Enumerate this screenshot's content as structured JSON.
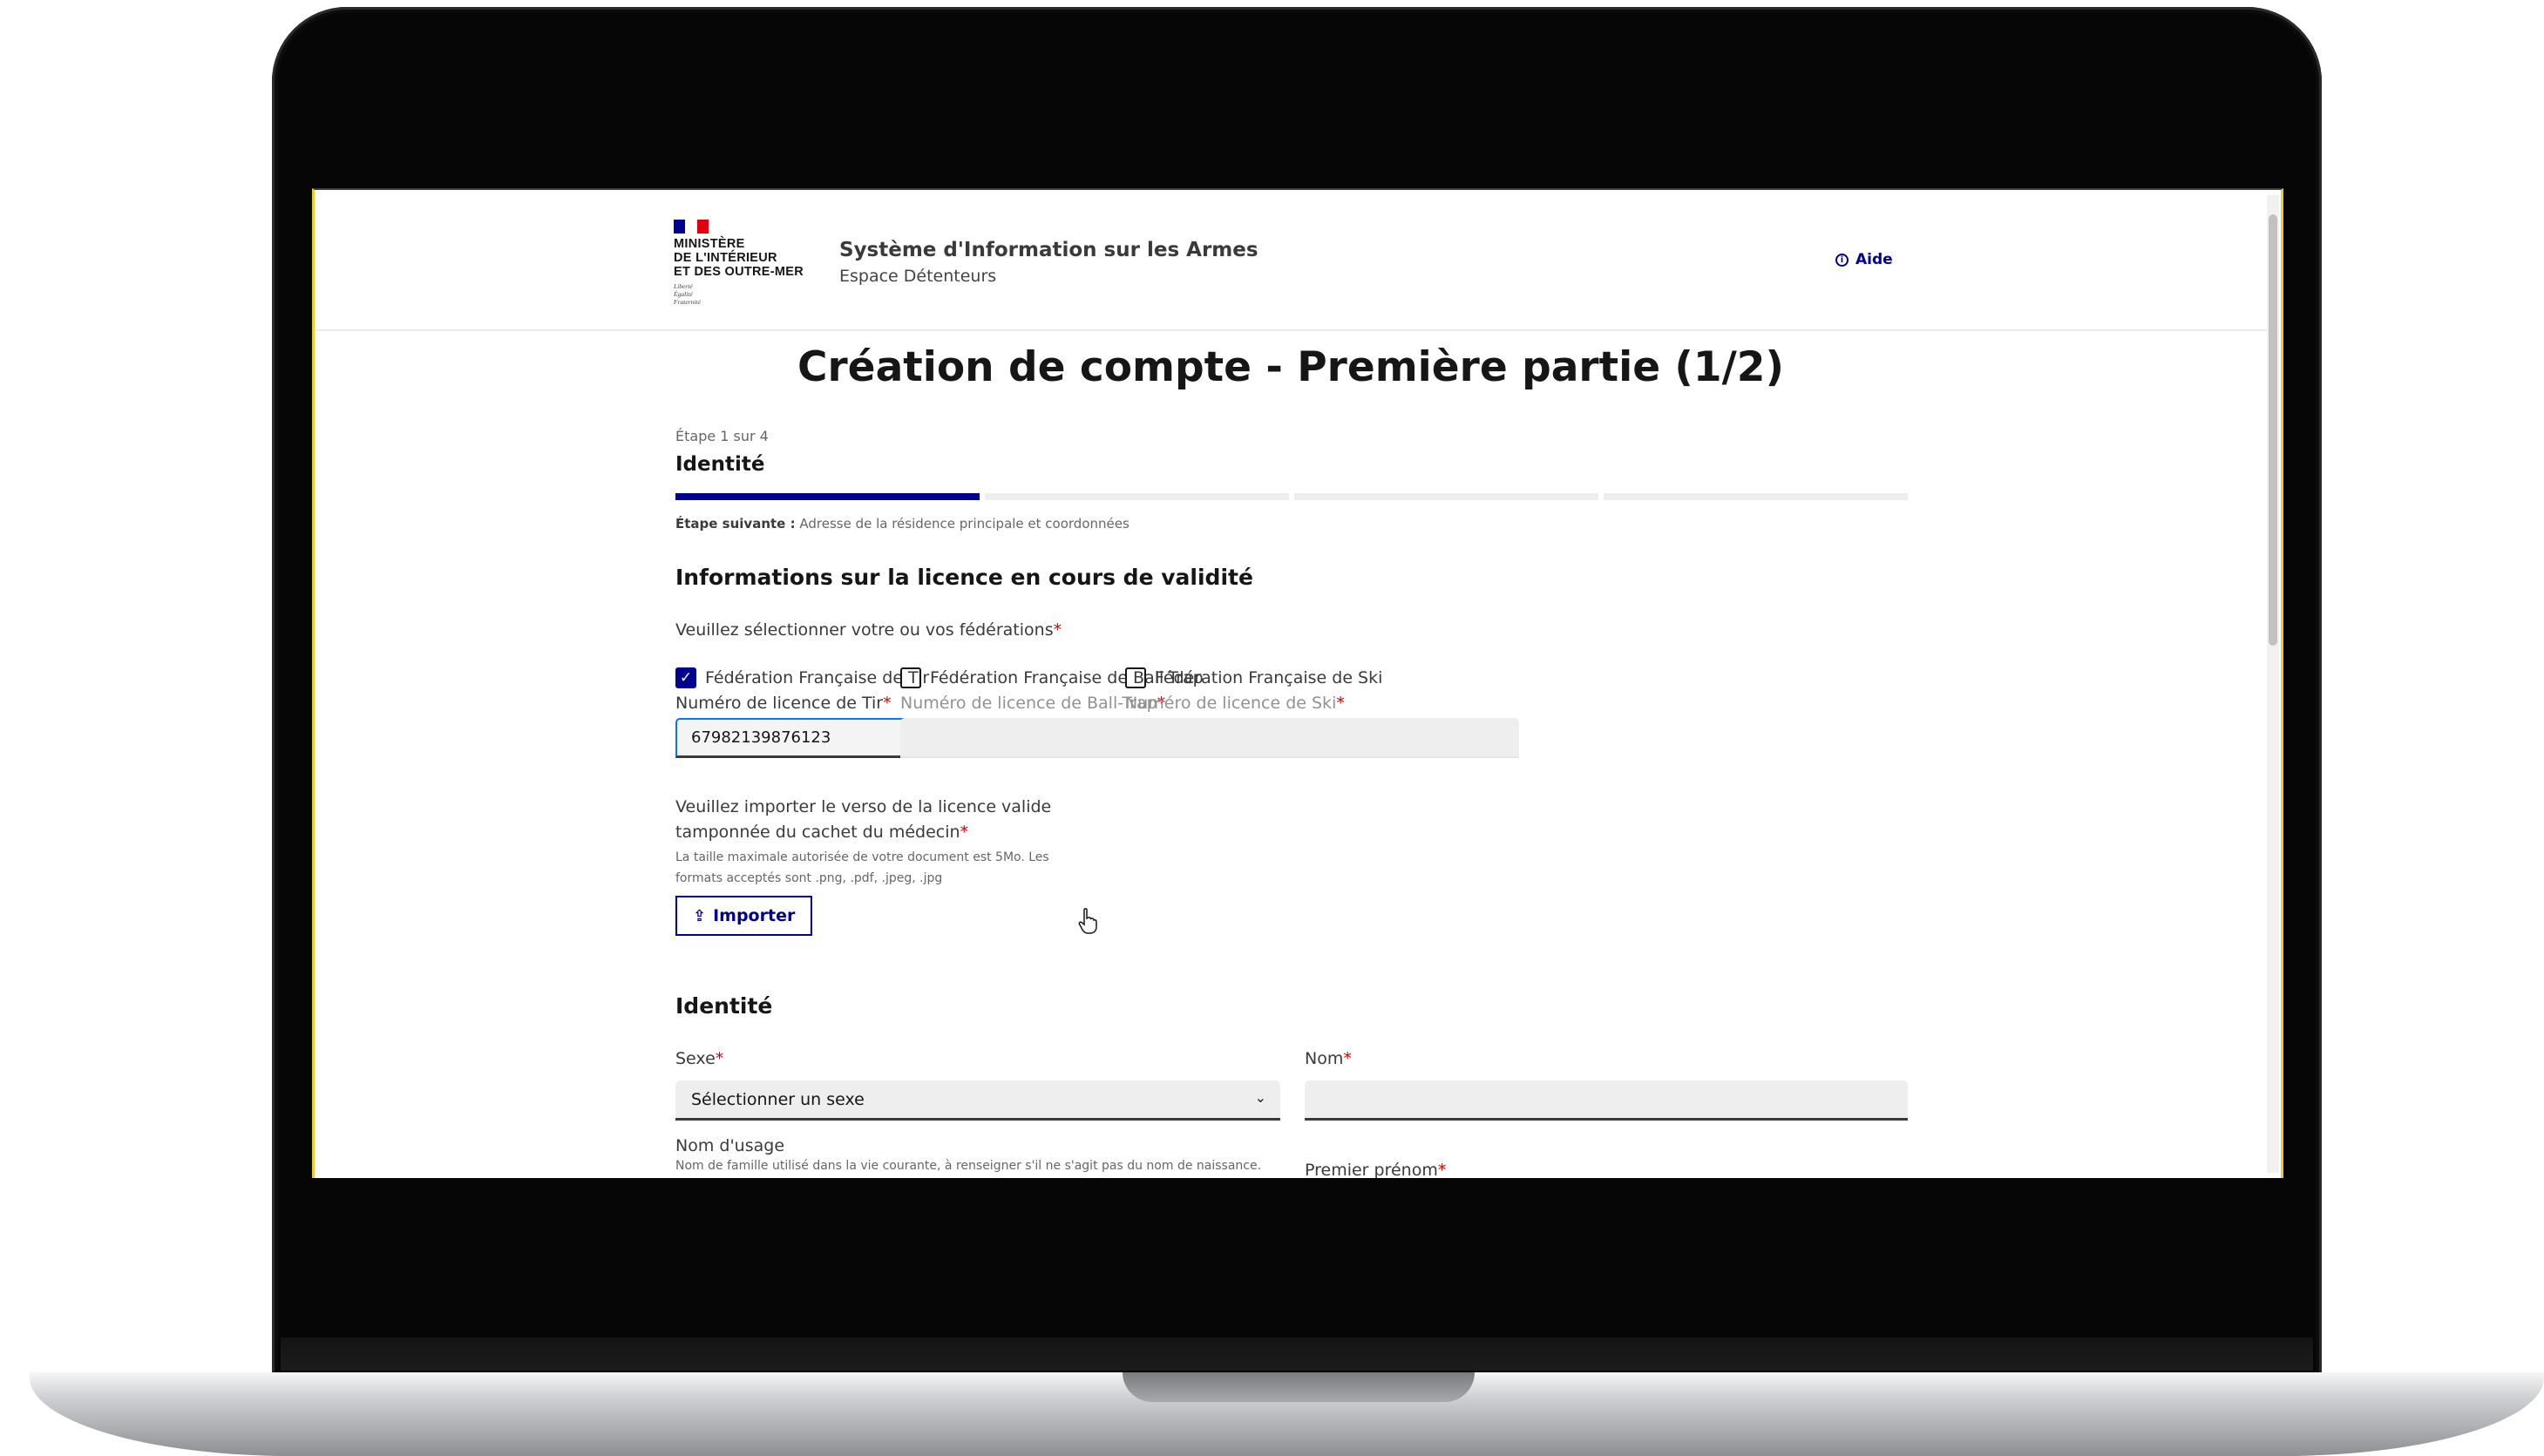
{
  "header": {
    "ministry": "MINISTÈRE\nDE L'INTÉRIEUR\nET DES OUTRE-MER",
    "motto": "Liberté\nÉgalité\nFraternité",
    "service_title": "Système d'Information sur les Armes",
    "service_tagline": "Espace Détenteurs",
    "help_label": "Aide"
  },
  "page": {
    "title": "Création de compte - Première partie (1/2)"
  },
  "stepper": {
    "count": "Étape 1 sur 4",
    "current_title": "Identité",
    "total_steps": 4,
    "current_step": 1,
    "next_prefix": "Étape suivante :",
    "next_title": "Adresse de la résidence principale et coordonnées"
  },
  "licence": {
    "section_title": "Informations sur la licence en cours de validité",
    "legend": "Veuillez sélectionner votre ou vos fédérations",
    "federations": [
      {
        "label": "Fédération Française de Tir",
        "checked": true,
        "field_label": "Numéro de licence de Tir",
        "value": "67982139876123"
      },
      {
        "label": "Fédération Française de Ball-Trap",
        "checked": false,
        "field_label": "Numéro de licence de Ball-Trap",
        "value": ""
      },
      {
        "label": "Fédération Française de Ski",
        "checked": false,
        "field_label": "Numéro de licence de Ski",
        "value": ""
      }
    ],
    "upload_label": "Veuillez importer le verso de la licence valide tamponnée du cachet du médecin",
    "upload_hint": "La taille maximale autorisée de votre document est 5Mo. Les formats acceptés sont .png, .pdf, .jpeg, .jpg",
    "upload_button": "Importer"
  },
  "identity": {
    "section_title": "Identité",
    "sexe_label": "Sexe",
    "sexe_placeholder": "Sélectionner un sexe",
    "nom_label": "Nom",
    "nom_usage_label": "Nom d'usage",
    "nom_usage_hint": "Nom de famille utilisé dans la vie courante, à renseigner s'il ne s'agit pas du nom de naissance.",
    "premier_prenom_label": "Premier prénom"
  },
  "required_mark": "*",
  "colors": {
    "primary": "#000091",
    "required": "#ce0500",
    "flag_blue": "#000091",
    "flag_white": "#ffffff",
    "flag_red": "#e1000f"
  }
}
